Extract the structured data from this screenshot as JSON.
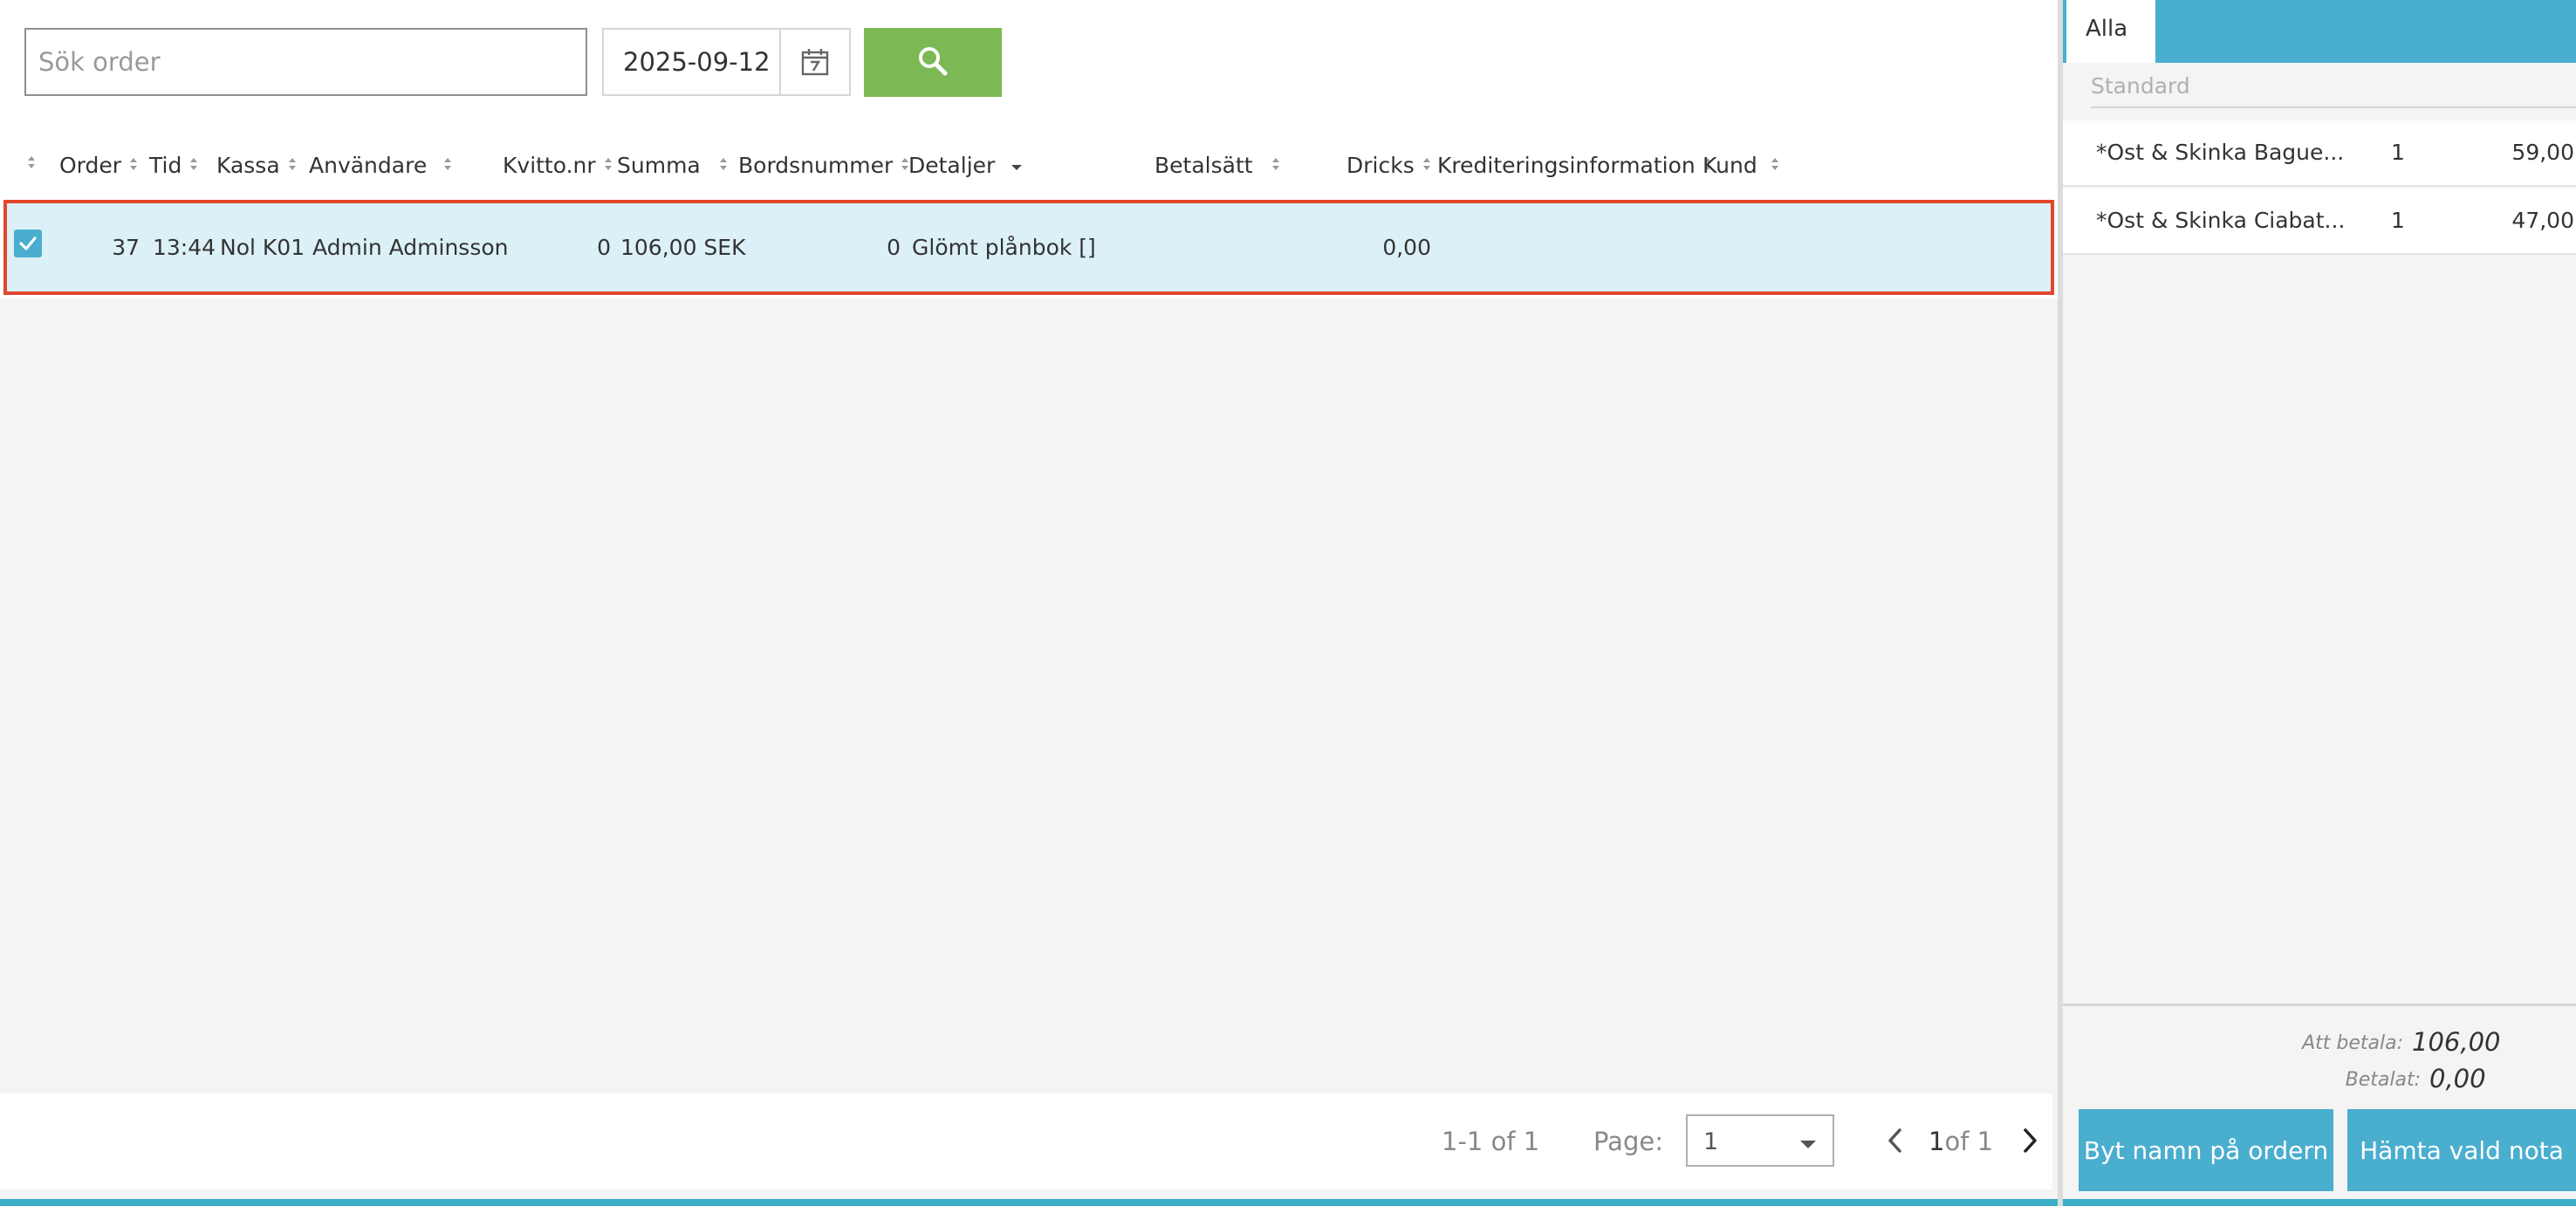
{
  "search": {
    "placeholder": "Sök order",
    "date": "2025-09-12"
  },
  "columns": {
    "order": "Order",
    "tid": "Tid",
    "kassa": "Kassa",
    "anvandare": "Användare",
    "kvitto": "Kvitto.nr",
    "summa": "Summa",
    "bordsnummer": "Bordsnummer",
    "detaljer": "Detaljer",
    "betalsatt": "Betalsätt",
    "dricks": "Dricks",
    "kreditering": "Krediteringsinformation",
    "kund": "Kund"
  },
  "row": {
    "order": "37",
    "tid": "13:44",
    "kassa": "Nol K01",
    "anvandare": "Admin Adminsson",
    "kvitto": "0",
    "summa": "106,00 SEK",
    "bordsnummer": "0",
    "detaljer": "Glömt plånbok []",
    "betalsatt": "",
    "dricks": "0,00",
    "kreditering": "",
    "kund": ""
  },
  "pagination": {
    "range": "1-1 of 1",
    "page_label": "Page:",
    "page_value": "1",
    "current": "1",
    "of_total": "of 1"
  },
  "side": {
    "tab_all": "Alla",
    "section": "Standard",
    "items": [
      {
        "name": "*Ost & Skinka Bague...",
        "qty": "1",
        "price": "59,00"
      },
      {
        "name": "*Ost & Skinka Ciabat...",
        "qty": "1",
        "price": "47,00"
      }
    ],
    "att_betala_label": "Att betala:",
    "att_betala_value": "106,00",
    "betalat_label": "Betalat:",
    "betalat_value": "0,00",
    "rename_button": "Byt namn på ordern",
    "fetch_button": "Hämta vald nota"
  },
  "colors": {
    "accent_blue": "#4aaecf",
    "search_green": "#7cb955",
    "selected_row": "#dcf1f7",
    "highlight_border": "#e0472d"
  }
}
